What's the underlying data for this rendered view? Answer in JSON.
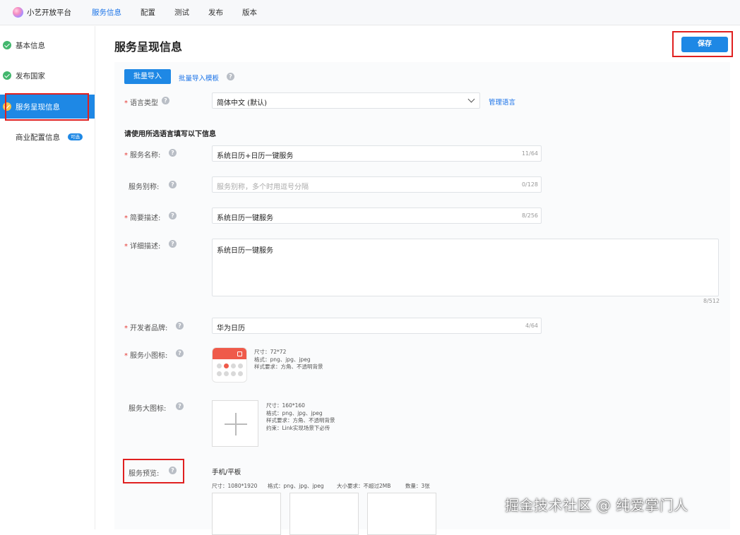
{
  "app": {
    "brand": "小艺开放平台",
    "nav": [
      "服务信息",
      "配置",
      "测试",
      "发布",
      "版本"
    ],
    "nav_active_index": 0
  },
  "sidebar": {
    "items": [
      {
        "label": "基本信息",
        "status": "done"
      },
      {
        "label": "发布国家",
        "status": "done"
      },
      {
        "label": "服务呈现信息",
        "status": "active"
      },
      {
        "label": "商业配置信息",
        "badge": "可选"
      }
    ]
  },
  "page": {
    "title": "服务呈现信息",
    "save_label": "保存"
  },
  "batch": {
    "import_label": "批量导入",
    "template_label": "批量导入模板"
  },
  "language": {
    "label": "语言类型",
    "value": "简体中文 (默认)",
    "manage_label": "管理语言"
  },
  "section_title": "请使用所选语言填写以下信息",
  "fields": {
    "service_name": {
      "label": "服务名称:",
      "value": "系统日历+日历一键服务",
      "count": "11/64"
    },
    "service_alias": {
      "label": "服务别称:",
      "placeholder": "服务别称，多个时用逗号分隔",
      "count": "0/128"
    },
    "brief_desc": {
      "label": "简要描述:",
      "value": "系统日历一键服务",
      "count": "8/256"
    },
    "detail_desc": {
      "label": "详细描述:",
      "value": "系统日历一键服务",
      "count": "8/512"
    },
    "developer_brand": {
      "label": "开发者品牌:",
      "value": "华为日历",
      "count": "4/64"
    }
  },
  "small_icon": {
    "label": "服务小图标:",
    "spec": [
      "尺寸：72*72",
      "格式：png、jpg、jpeg",
      "样式要求：方角、不透明背景"
    ]
  },
  "large_icon": {
    "label": "服务大图标:",
    "spec": [
      "尺寸：160*160",
      "格式：png、jpg、jpeg",
      "样式要求：方角、不透明背景",
      "约束：Link实现场景下必传"
    ]
  },
  "preview": {
    "label": "服务预览:",
    "device": "手机/平板",
    "size": "尺寸：1080*1920",
    "format": "格式：png、jpg、jpeg",
    "max_size": "大小要求：不超过2MB",
    "quantity": "数量：3张"
  },
  "watermark": "掘金技术社区 @ 纯爱掌门人",
  "colors": {
    "primary": "#1e88e5",
    "success": "#43b76e",
    "required": "#e53935",
    "annotation": "#e02020"
  }
}
